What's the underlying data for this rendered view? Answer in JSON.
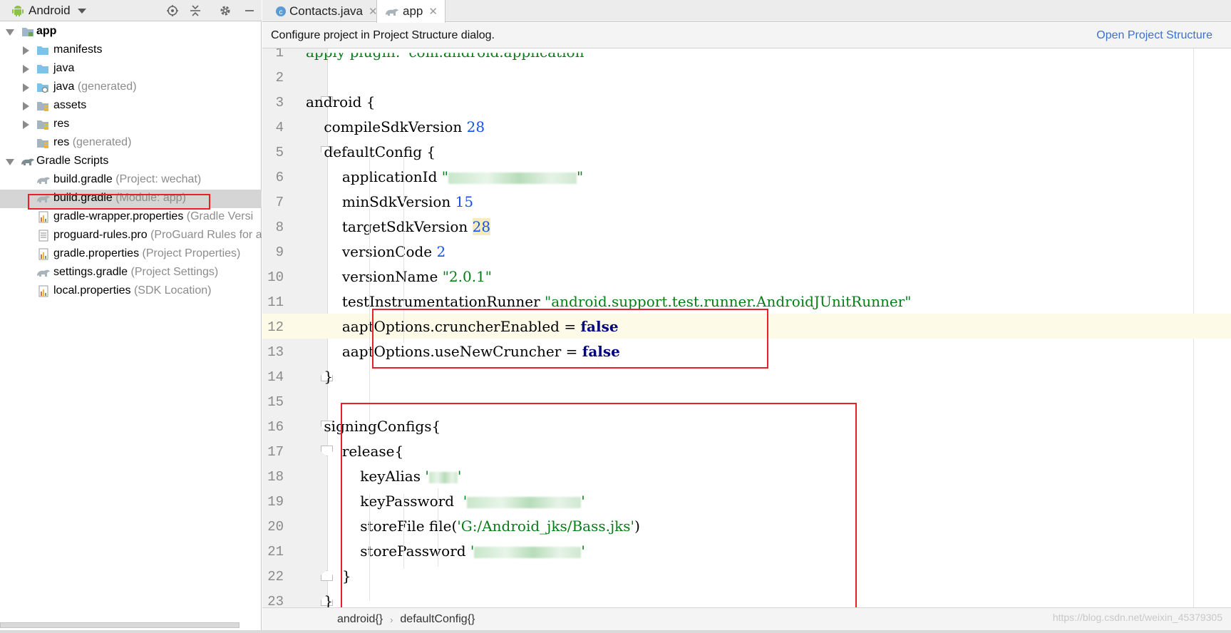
{
  "project_panel": {
    "view_selector": "Android",
    "tree": [
      {
        "label": "app",
        "hint": "",
        "depth": 0,
        "expanded": true,
        "bold": true,
        "icon": "module-folder-icon"
      },
      {
        "label": "manifests",
        "hint": "",
        "depth": 1,
        "collapsed": true,
        "icon": "folder-icon"
      },
      {
        "label": "java",
        "hint": "",
        "depth": 1,
        "collapsed": true,
        "icon": "folder-icon"
      },
      {
        "label": "java",
        "hint": "(generated)",
        "depth": 1,
        "collapsed": true,
        "icon": "generated-folder-icon"
      },
      {
        "label": "assets",
        "hint": "",
        "depth": 1,
        "collapsed": true,
        "icon": "resource-folder-icon"
      },
      {
        "label": "res",
        "hint": "",
        "depth": 1,
        "collapsed": true,
        "icon": "resource-folder-icon"
      },
      {
        "label": "res",
        "hint": "(generated)",
        "depth": 1,
        "collapsed": false,
        "icon": "resource-folder-icon"
      },
      {
        "label": "Gradle Scripts",
        "hint": "",
        "depth": 0,
        "expanded": true,
        "icon": "gradle-icon"
      },
      {
        "label": "build.gradle",
        "hint": "(Project: wechat)",
        "depth": 1,
        "icon": "gradle-file-icon"
      },
      {
        "label": "build.gradle",
        "hint": "(Module: app)",
        "depth": 1,
        "selected": true,
        "icon": "gradle-file-icon"
      },
      {
        "label": "gradle-wrapper.properties",
        "hint": "(Gradle Versi",
        "depth": 1,
        "icon": "properties-file-icon"
      },
      {
        "label": "proguard-rules.pro",
        "hint": "(ProGuard Rules for a",
        "depth": 1,
        "icon": "text-file-icon"
      },
      {
        "label": "gradle.properties",
        "hint": "(Project Properties)",
        "depth": 1,
        "icon": "properties-file-icon"
      },
      {
        "label": "settings.gradle",
        "hint": "(Project Settings)",
        "depth": 1,
        "icon": "gradle-file-icon"
      },
      {
        "label": "local.properties",
        "hint": "(SDK Location)",
        "depth": 1,
        "icon": "properties-file-icon"
      }
    ]
  },
  "tabs": [
    {
      "label": "Contacts.java",
      "icon": "java-class-icon",
      "active": false
    },
    {
      "label": "app",
      "icon": "gradle-icon",
      "active": true
    }
  ],
  "notification": {
    "message": "Configure project in Project Structure dialog.",
    "action": "Open Project Structure"
  },
  "editor": {
    "lines": [
      {
        "n": "1",
        "segments": [
          {
            "t": "apply plugin: 'com.android.application'",
            "c": "partial"
          }
        ]
      },
      {
        "n": "2",
        "segments": []
      },
      {
        "n": "3",
        "segments": [
          {
            "t": "android {",
            "c": "plain"
          }
        ]
      },
      {
        "n": "4",
        "segments": [
          {
            "t": "    compileSdkVersion ",
            "c": "plain"
          },
          {
            "t": "28",
            "c": "num"
          }
        ]
      },
      {
        "n": "5",
        "segments": [
          {
            "t": "    defaultConfig {",
            "c": "plain"
          }
        ]
      },
      {
        "n": "6",
        "segments": [
          {
            "t": "        applicationId ",
            "c": "plain"
          },
          {
            "t": "\"",
            "c": "str"
          },
          {
            "t": "",
            "c": "blur",
            "w": 180
          },
          {
            "t": "\"",
            "c": "str"
          }
        ]
      },
      {
        "n": "7",
        "segments": [
          {
            "t": "        minSdkVersion ",
            "c": "plain"
          },
          {
            "t": "15",
            "c": "num"
          }
        ]
      },
      {
        "n": "8",
        "segments": [
          {
            "t": "        targetSdkVersion ",
            "c": "plain"
          },
          {
            "t": "28",
            "c": "numhl"
          }
        ]
      },
      {
        "n": "9",
        "segments": [
          {
            "t": "        versionCode ",
            "c": "plain"
          },
          {
            "t": "2",
            "c": "num"
          }
        ]
      },
      {
        "n": "10",
        "segments": [
          {
            "t": "        versionName ",
            "c": "plain"
          },
          {
            "t": "\"2.0.1\"",
            "c": "str"
          }
        ]
      },
      {
        "n": "11",
        "segments": [
          {
            "t": "        testInstrumentationRunner ",
            "c": "plain"
          },
          {
            "t": "\"android.support.test.runner.AndroidJUnitRunner\"",
            "c": "str"
          }
        ]
      },
      {
        "n": "12",
        "segments": [
          {
            "t": "        aaptOptions.cruncherEnabled = ",
            "c": "plain"
          },
          {
            "t": "false",
            "c": "kw"
          }
        ]
      },
      {
        "n": "13",
        "segments": [
          {
            "t": "        aaptOptions.useNewCruncher = ",
            "c": "plain"
          },
          {
            "t": "false",
            "c": "kw"
          }
        ]
      },
      {
        "n": "14",
        "segments": [
          {
            "t": "    }",
            "c": "plain"
          }
        ]
      },
      {
        "n": "15",
        "segments": []
      },
      {
        "n": "16",
        "segments": [
          {
            "t": "    signingConfigs{",
            "c": "plain"
          }
        ]
      },
      {
        "n": "17",
        "segments": [
          {
            "t": "        release{",
            "c": "plain"
          }
        ]
      },
      {
        "n": "18",
        "segments": [
          {
            "t": "            keyAlias ",
            "c": "plain"
          },
          {
            "t": "'",
            "c": "str"
          },
          {
            "t": "",
            "c": "blur",
            "w": 40
          },
          {
            "t": "'",
            "c": "str"
          }
        ]
      },
      {
        "n": "19",
        "segments": [
          {
            "t": "            keyPassword  ",
            "c": "plain"
          },
          {
            "t": "'",
            "c": "str"
          },
          {
            "t": "",
            "c": "blur",
            "w": 160
          },
          {
            "t": "'",
            "c": "str"
          }
        ]
      },
      {
        "n": "20",
        "segments": [
          {
            "t": "            storeFile file(",
            "c": "plain"
          },
          {
            "t": "'G:/Android_jks/Bass.jks'",
            "c": "str"
          },
          {
            "t": ")",
            "c": "plain"
          }
        ]
      },
      {
        "n": "21",
        "segments": [
          {
            "t": "            storePassword ",
            "c": "plain"
          },
          {
            "t": "'",
            "c": "str"
          },
          {
            "t": "",
            "c": "blur",
            "w": 150
          },
          {
            "t": "'",
            "c": "str"
          }
        ]
      },
      {
        "n": "22",
        "segments": [
          {
            "t": "        }",
            "c": "plain"
          }
        ]
      },
      {
        "n": "23",
        "segments": [
          {
            "t": "    }",
            "c": "plain"
          }
        ]
      }
    ],
    "current_line": "12"
  },
  "breadcrumb": [
    "android{}",
    "defaultConfig{}"
  ],
  "watermark": "https://blog.csdn.net/weixin_45379305",
  "colors": {
    "keyword": "#000080",
    "number": "#1750eb",
    "string": "#067d17",
    "link": "#3a72c9",
    "highlight_box": "#e8202a"
  }
}
